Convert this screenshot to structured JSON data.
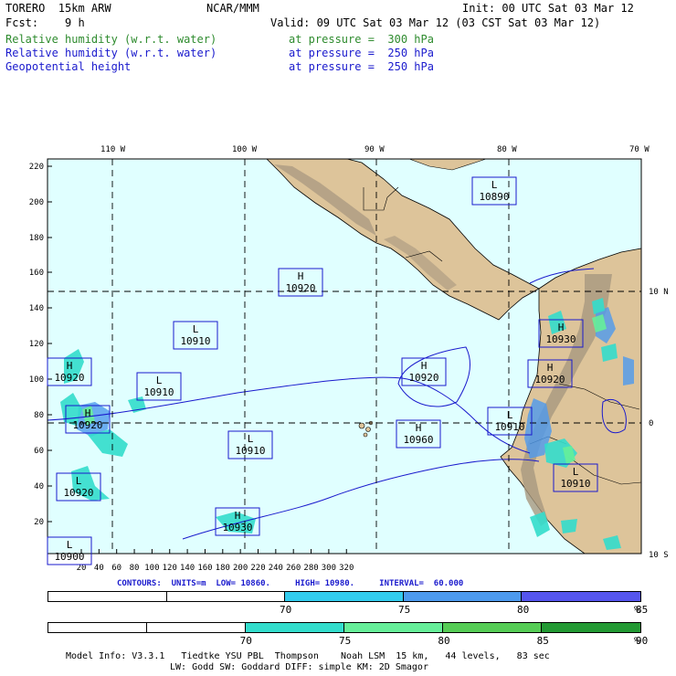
{
  "header": {
    "model": "TORERO  15km ARW",
    "center": "NCAR/MMM",
    "init": "Init: 00 UTC Sat 03 Mar 12",
    "fcst": "Fcst:    9 h",
    "valid": "Valid: 09 UTC Sat 03 Mar 12 (03 CST Sat 03 Mar 12)"
  },
  "fields": [
    {
      "name": "Relative humidity (w.r.t. water)",
      "level": "at pressure =  300 hPa",
      "color": "#2e8b2e"
    },
    {
      "name": "Relative humidity (w.r.t. water)",
      "level": "at pressure =  250 hPa",
      "color": "#1a1acd"
    },
    {
      "name": "Geopotential height",
      "level": "at pressure =  250 hPa",
      "color": "#1a1acd"
    }
  ],
  "map": {
    "top_lon_labels": [
      "110 W",
      "100 W",
      "90 W",
      "80 W",
      "70 W"
    ],
    "right_lat_labels": [
      "10 N",
      "0",
      "10 S"
    ],
    "left_y_ticks": [
      "220",
      "200",
      "180",
      "160",
      "140",
      "120",
      "100",
      "80",
      "60",
      "40",
      "20"
    ],
    "bottom_x_ticks": [
      "20",
      "40",
      "60",
      "80",
      "100",
      "120",
      "140",
      "160",
      "180",
      "200",
      "220",
      "240",
      "260",
      "280",
      "300",
      "320"
    ],
    "colors": {
      "ocean": "#e0ffff",
      "land": "#ddc49a",
      "mountain": "#a89880",
      "grid": "#000000",
      "contour": "#1a1acd"
    },
    "labels": [
      {
        "type": "L",
        "value": "10890"
      },
      {
        "type": "H",
        "value": "10920"
      },
      {
        "type": "H",
        "value": "10930"
      },
      {
        "type": "L",
        "value": "10910"
      },
      {
        "type": "H",
        "value": "10920"
      },
      {
        "type": "L",
        "value": "10910"
      },
      {
        "type": "H",
        "value": "10920"
      },
      {
        "type": "H",
        "value": "10920"
      },
      {
        "type": "H",
        "value": "10920"
      },
      {
        "type": "L",
        "value": "10910"
      },
      {
        "type": "L",
        "value": "10910"
      },
      {
        "type": "L",
        "value": "10920"
      },
      {
        "type": "H",
        "value": "10960"
      },
      {
        "type": "L",
        "value": "10910"
      },
      {
        "type": "H",
        "value": "10930"
      },
      {
        "type": "L",
        "value": "10900"
      }
    ]
  },
  "contour_info": "CONTOURS:  UNITS=m  LOW= 10860.     HIGH= 10980.     INTERVAL=  60.000",
  "legend_250": {
    "ticks": [
      "70",
      "75",
      "80",
      "85",
      "%"
    ],
    "colors": [
      "#ffffff",
      "#ffffff",
      "#33ccee",
      "#4d9aee",
      "#5555ee"
    ]
  },
  "legend_300": {
    "ticks": [
      "70",
      "75",
      "80",
      "85",
      "90",
      "%"
    ],
    "colors": [
      "#ffffff",
      "#ffffff",
      "#33ddcc",
      "#66ee99",
      "#55cc55",
      "#229933"
    ]
  },
  "footer": {
    "line1": "Model Info: V3.3.1   Tiedtke YSU PBL  Thompson    Noah LSM  15 km,   44 levels,   83 sec",
    "line2": "LW: Godd SW: Goddard DIFF: simple KM: 2D Smagor"
  }
}
